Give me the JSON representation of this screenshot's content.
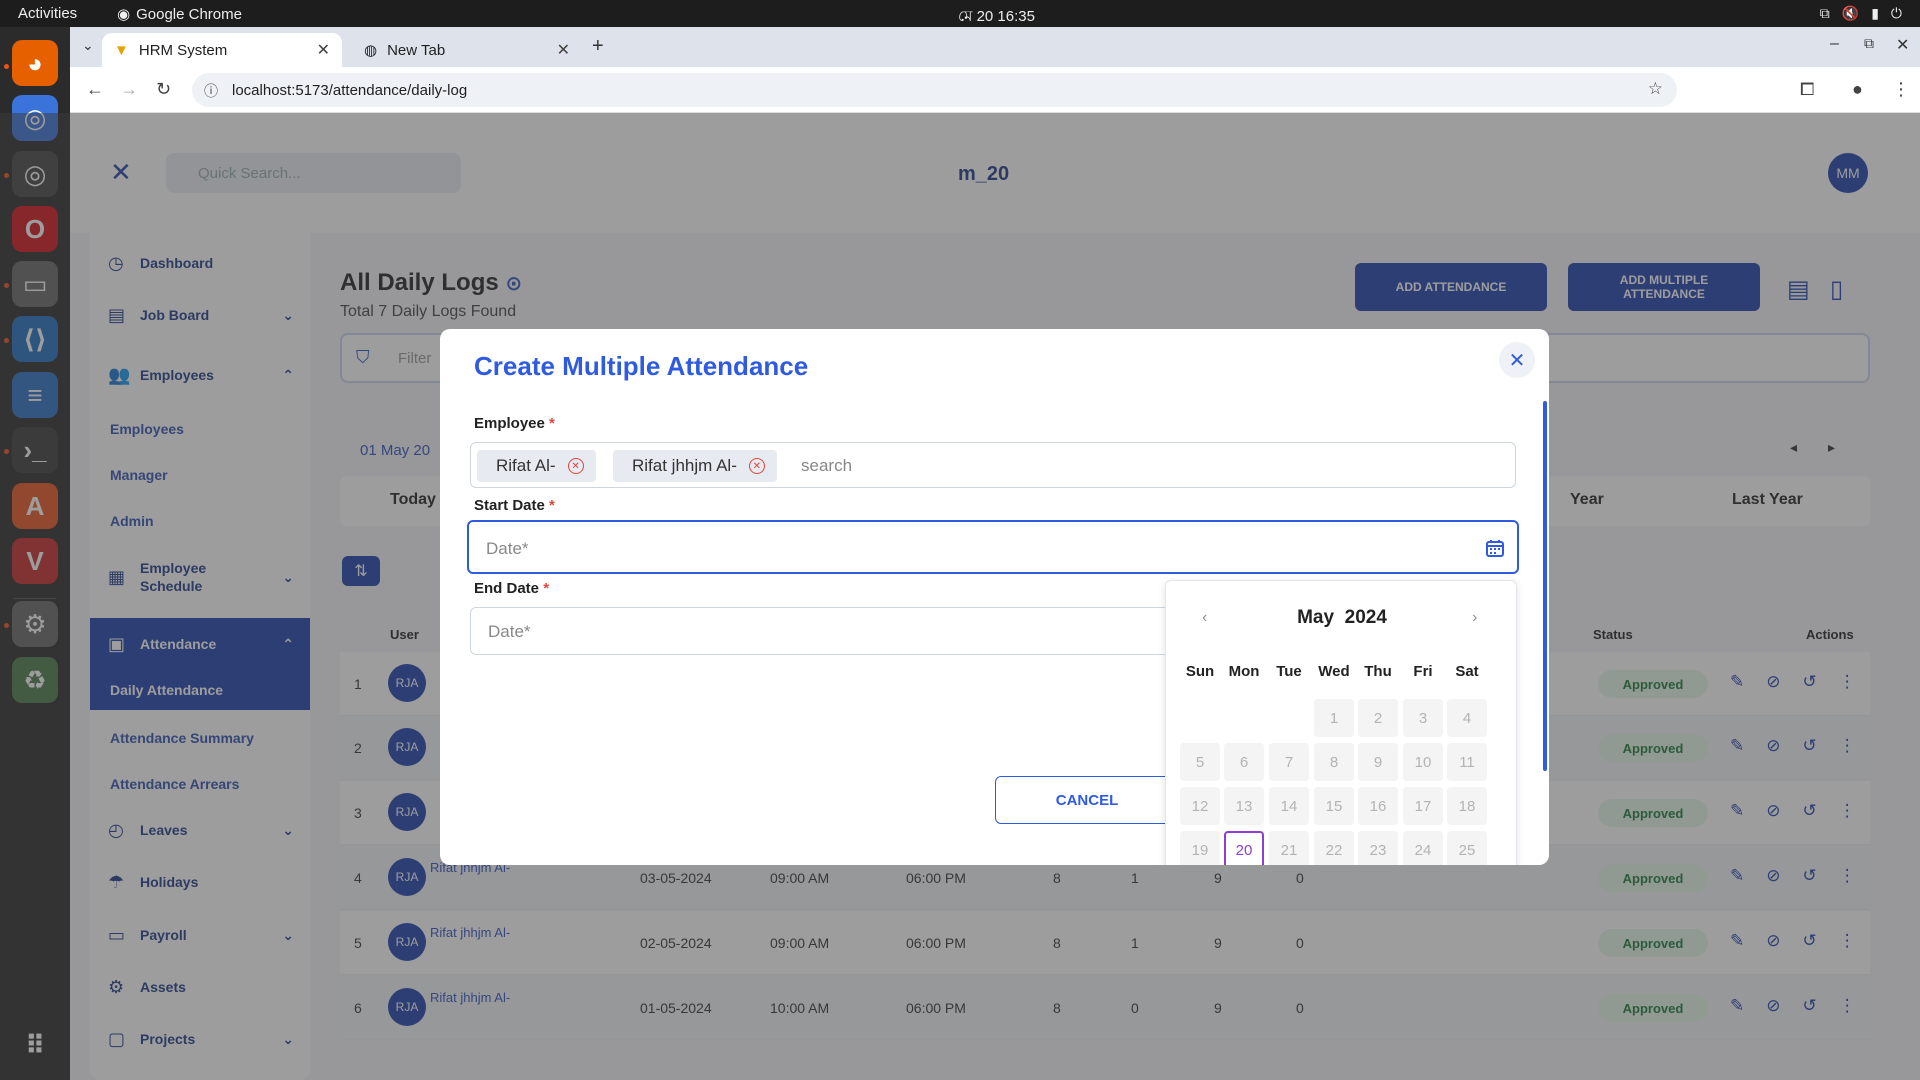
{
  "os": {
    "activities": "Activities",
    "app_name": "Google Chrome",
    "clock": "মে 20  16:35"
  },
  "browser": {
    "tabs": [
      {
        "label": "HRM System",
        "active": true
      },
      {
        "label": "New Tab",
        "active": false
      }
    ],
    "url": "localhost:5173/attendance/daily-log"
  },
  "app": {
    "search_placeholder": "Quick Search...",
    "brand": "m_20",
    "avatar": "MM",
    "sidebar": [
      {
        "label": "Dashboard",
        "icon": "dashboard-icon"
      },
      {
        "label": "Job Board",
        "icon": "inbox-icon"
      },
      {
        "label": "Employees",
        "icon": "users-icon"
      },
      {
        "label": "Employees",
        "sub": true
      },
      {
        "label": "Manager",
        "sub": true
      },
      {
        "label": "Admin",
        "sub": true
      },
      {
        "label": "Employee Schedule",
        "icon": "calendar-icon"
      },
      {
        "label": "Attendance",
        "icon": "attendance-icon",
        "active": true
      },
      {
        "label": "Daily Attendance",
        "sub": true,
        "active": true
      },
      {
        "label": "Attendance Summary",
        "sub": true
      },
      {
        "label": "Attendance Arrears",
        "sub": true
      },
      {
        "label": "Leaves",
        "icon": "clock-icon"
      },
      {
        "label": "Holidays",
        "icon": "holiday-icon"
      },
      {
        "label": "Payroll",
        "icon": "payroll-icon"
      },
      {
        "label": "Assets",
        "icon": "assets-icon"
      },
      {
        "label": "Projects",
        "icon": "projects-icon"
      }
    ],
    "page_title": "All Daily Logs",
    "page_subtitle": "Total 7 Daily Logs Found",
    "add_attendance": "ADD ATTENDANCE",
    "add_multiple": "ADD MULTIPLE ATTENDANCE",
    "filter_placeholder": "Filter",
    "date_range": "01 May 20",
    "period_tabs": [
      "Today",
      "Year",
      "Last Year"
    ],
    "table_headers": [
      "User",
      "Status",
      "Actions"
    ],
    "rows": [
      {
        "n": "1",
        "av": "RJA",
        "name": "",
        "date": "",
        "in": "",
        "out": "",
        "a": "",
        "b": "",
        "c": "",
        "d": "",
        "status": "Approved"
      },
      {
        "n": "2",
        "av": "RJA",
        "name": "",
        "date": "",
        "in": "",
        "out": "",
        "a": "",
        "b": "",
        "c": "",
        "d": "",
        "status": "Approved"
      },
      {
        "n": "3",
        "av": "RJA",
        "name": "",
        "date": "",
        "in": "",
        "out": "",
        "a": "",
        "b": "",
        "c": "",
        "d": "",
        "status": "Approved"
      },
      {
        "n": "4",
        "av": "RJA",
        "name": "Rifat jhhjm Al-",
        "date": "03-05-2024",
        "in": "09:00 AM",
        "out": "06:00 PM",
        "a": "8",
        "b": "1",
        "c": "9",
        "d": "0",
        "status": "Approved"
      },
      {
        "n": "5",
        "av": "RJA",
        "name": "Rifat jhhjm Al-",
        "date": "02-05-2024",
        "in": "09:00 AM",
        "out": "06:00 PM",
        "a": "8",
        "b": "1",
        "c": "9",
        "d": "0",
        "status": "Approved"
      },
      {
        "n": "6",
        "av": "RJA",
        "name": "Rifat jhhjm Al-",
        "date": "01-05-2024",
        "in": "10:00 AM",
        "out": "06:00 PM",
        "a": "8",
        "b": "0",
        "c": "9",
        "d": "0",
        "status": "Approved"
      }
    ]
  },
  "modal": {
    "title": "Create Multiple Attendance",
    "employee_label": "Employee",
    "required_mark": "*",
    "chips": [
      "Rifat Al-",
      "Rifat jhhjm Al-"
    ],
    "search_placeholder": "search",
    "start_label": "Start Date",
    "end_label": "End Date",
    "date_placeholder": "Date*",
    "cancel": "CANCEL",
    "accent_color": "#2f5be0"
  },
  "calendar": {
    "month": "May",
    "year": "2024",
    "weekdays": [
      "Sun",
      "Mon",
      "Tue",
      "Wed",
      "Thu",
      "Fri",
      "Sat"
    ],
    "first_weekday": 3,
    "visible_days": 25,
    "today": 20
  }
}
